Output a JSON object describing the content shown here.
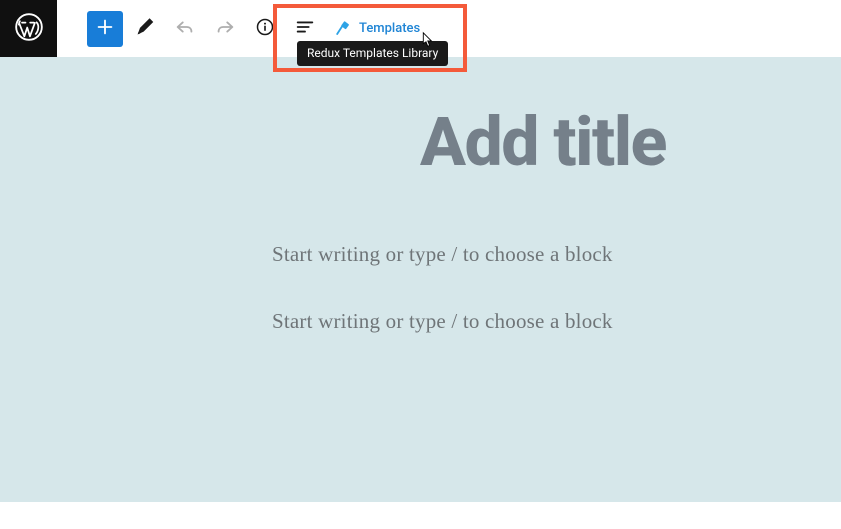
{
  "toolbar": {
    "templates_label": "Templates",
    "tooltip": "Redux Templates Library"
  },
  "editor": {
    "title_placeholder": "Add title",
    "block_placeholder_1": "Start writing or type / to choose a block",
    "block_placeholder_2": "Start writing or type / to choose a block"
  },
  "icons": {
    "wp_logo": "wordpress-logo",
    "add": "plus-icon",
    "edit": "pencil-icon",
    "undo": "undo-icon",
    "redo": "redo-icon",
    "info": "info-icon",
    "list": "list-icon",
    "templates": "redux-icon",
    "cursor": "pointer-cursor"
  },
  "colors": {
    "primary": "#187dd8",
    "highlight": "#f45a3a",
    "canvas_bg": "#d6e7ea",
    "placeholder": "#75808a"
  }
}
